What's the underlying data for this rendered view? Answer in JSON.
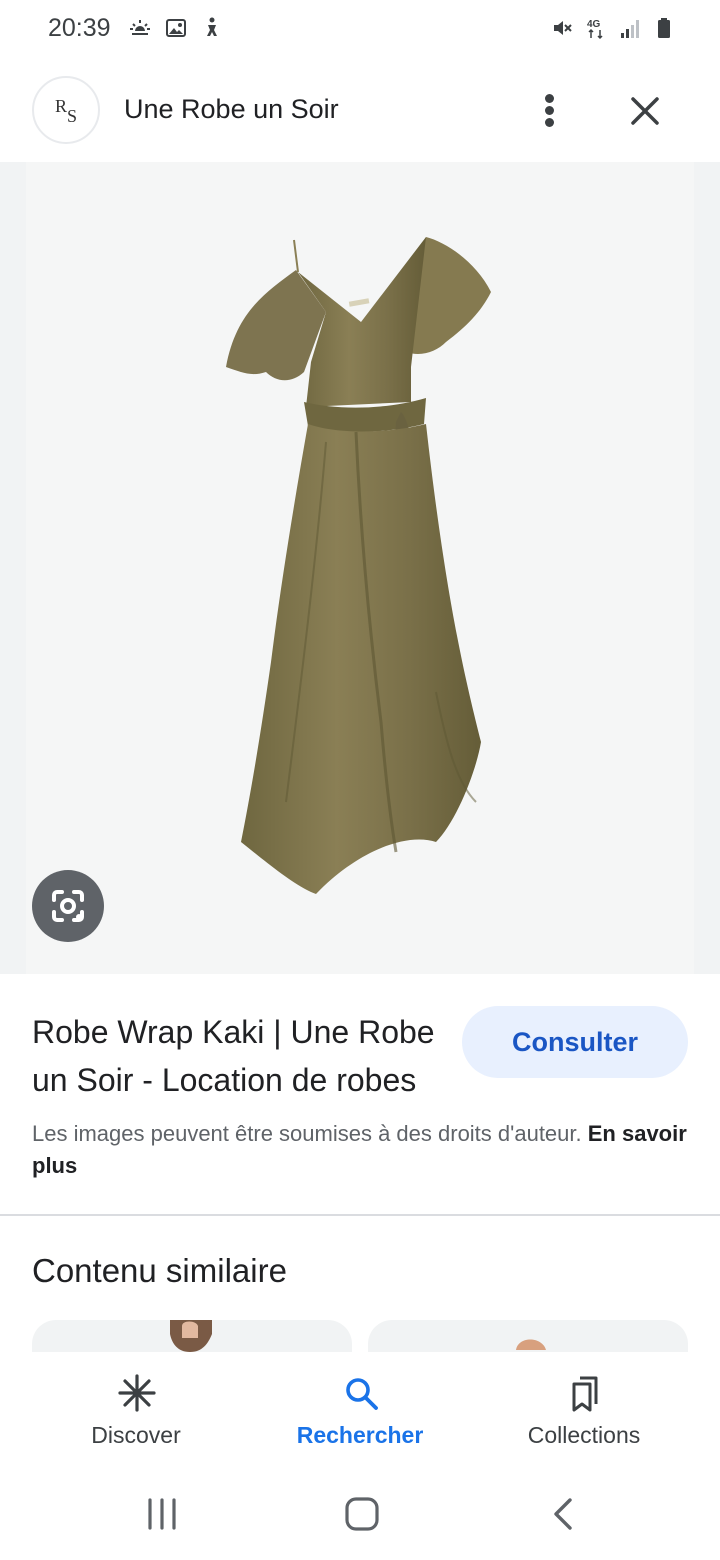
{
  "status_bar": {
    "time": "20:39",
    "left_icons": [
      "weather-icon",
      "gallery-icon",
      "accessibility-icon"
    ],
    "right_icons": [
      "mute-icon",
      "network-4g-icon",
      "signal-icon",
      "battery-icon"
    ],
    "network_label": "4G"
  },
  "header": {
    "logo_letter_top": "R",
    "logo_letter_bottom": "S",
    "site_name": "Une Robe un Soir",
    "more_icon": "more-vert-icon",
    "close_icon": "close-icon"
  },
  "image": {
    "lens_icon": "google-lens-icon",
    "dress_color": "#857a50"
  },
  "result": {
    "title": "Robe Wrap Kaki | Une Robe un Soir - Location de robes",
    "visit_label": "Consulter",
    "copyright_text": "Les images peuvent être soumises à des droits d'auteur.",
    "learn_more_label": "En savoir plus"
  },
  "similar": {
    "title": "Contenu similaire"
  },
  "bottom_nav": {
    "items": [
      {
        "label": "Discover",
        "icon": "discover-icon",
        "active": false
      },
      {
        "label": "Rechercher",
        "icon": "search-icon",
        "active": true
      },
      {
        "label": "Collections",
        "icon": "collections-icon",
        "active": false
      }
    ]
  },
  "system_nav": {
    "recents_icon": "recents-icon",
    "home_icon": "home-icon",
    "back_icon": "back-icon"
  },
  "colors": {
    "accent": "#1a73e8",
    "visit_bg": "#e8f0fe",
    "visit_text": "#1a56c4",
    "lens_bg": "#5f6368"
  }
}
